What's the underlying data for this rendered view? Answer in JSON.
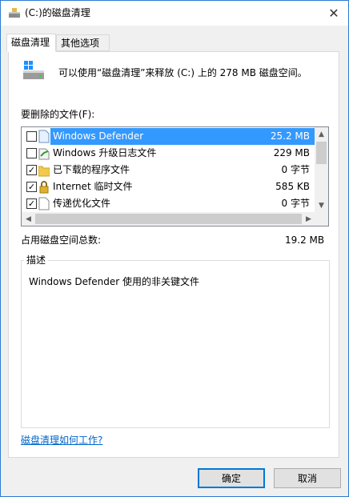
{
  "window": {
    "title": "(C:)的磁盘清理",
    "close_label": "✕"
  },
  "tabs": [
    {
      "label": "磁盘清理",
      "active": true
    },
    {
      "label": "其他选项",
      "active": false
    }
  ],
  "intro": "可以使用“磁盘清理”来释放  (C:) 上的 278 MB 磁盘空间。",
  "files_label": "要删除的文件(F):",
  "files": [
    {
      "name": "Windows Defender",
      "size": "25.2 MB",
      "checked": false,
      "selected": true,
      "icon": "file-icon"
    },
    {
      "name": "Windows 升级日志文件",
      "size": "229 MB",
      "checked": false,
      "selected": false,
      "icon": "log-file-icon"
    },
    {
      "name": "已下载的程序文件",
      "size": "0 字节",
      "checked": true,
      "selected": false,
      "icon": "folder-icon"
    },
    {
      "name": "Internet 临时文件",
      "size": "585 KB",
      "checked": true,
      "selected": false,
      "icon": "lock-icon"
    },
    {
      "name": "传递优化文件",
      "size": "0 字节",
      "checked": true,
      "selected": false,
      "icon": "file-icon"
    }
  ],
  "total": {
    "label": "占用磁盘空间总数:",
    "value": "19.2 MB"
  },
  "description": {
    "title": "描述",
    "text": "Windows Defender 使用的非关键文件"
  },
  "help_link": "磁盘清理如何工作?",
  "buttons": {
    "ok": "确定",
    "cancel": "取消"
  },
  "colors": {
    "selection": "#3399ff",
    "link": "#0066cc",
    "accent": "#0078d7"
  }
}
